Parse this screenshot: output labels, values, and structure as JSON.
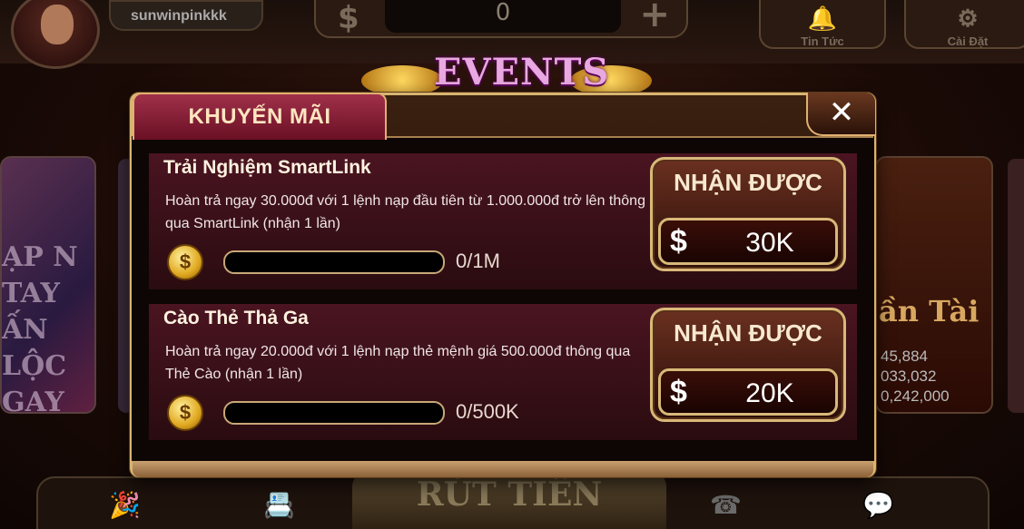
{
  "header": {
    "username": "sunwinpinkkk",
    "balance": "0",
    "nav": [
      {
        "label": "Tin Tức",
        "icon": "bell-icon"
      },
      {
        "label": "Cài Đặt",
        "icon": "gear-icon"
      }
    ]
  },
  "events_banner": "EVENTS",
  "dialog": {
    "tab_label": "KHUYẾN MÃI",
    "close_label": "✕",
    "promotions": [
      {
        "title": "Trải Nghiệm SmartLink",
        "description": "Hoàn trả ngay 30.000đ với 1 lệnh nạp đầu tiên từ 1.000.000đ trở lên thông qua SmartLink (nhận 1 lần)",
        "progress_text": "0/1M",
        "progress_fraction": 0,
        "button_label": "NHẬN ĐƯỢC",
        "reward": "30K"
      },
      {
        "title": "Cào Thẻ Thả Ga",
        "description": "Hoàn trả ngay 20.000đ với 1 lệnh nạp thẻ mệnh giá 500.000đ thông qua Thẻ Cào (nhận 1 lần)",
        "progress_text": "0/500K",
        "progress_fraction": 0,
        "button_label": "NHẬN ĐƯỢC",
        "reward": "20K"
      }
    ]
  },
  "background": {
    "left_card_text": "ẠP N TAY ẤN LỘC GAY",
    "right_card_text": "ần Tài",
    "right_card_numbers": [
      "45,884",
      "033,032",
      "0,242,000"
    ],
    "bottom_center": "RÚT TIỀN"
  },
  "colors": {
    "accent_gold": "#d8b878",
    "tab_red": "#a0304a",
    "row_bg": "#4a1420"
  }
}
